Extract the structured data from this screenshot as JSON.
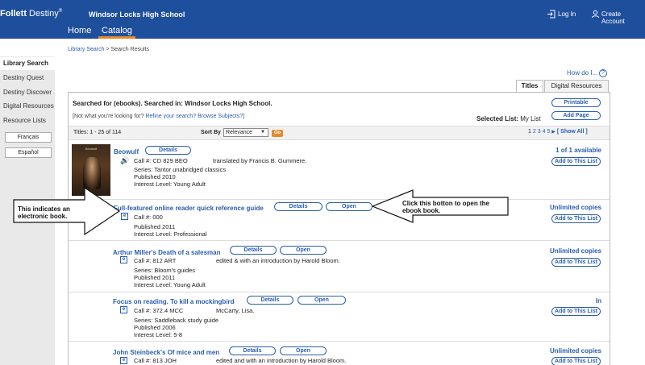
{
  "header": {
    "brand_bold": "Follett",
    "brand_light": " Destiny",
    "brand_mark": "®",
    "school": "Windsor Locks High School",
    "login": "Log In",
    "create_account": "Create Account",
    "nav": [
      "Home",
      "Catalog"
    ]
  },
  "breadcrumb": {
    "link": "Library Search",
    "separator": " > ",
    "current": "Search Results"
  },
  "sidebar": {
    "items": [
      "Library Search",
      "Destiny Quest",
      "Destiny Discover",
      "Digital Resources",
      "Resource Lists"
    ],
    "languages": [
      "Français",
      "Español"
    ]
  },
  "help": {
    "label": "How do I...",
    "icon": "?"
  },
  "tabs": [
    "Titles",
    "Digital Resources"
  ],
  "search": {
    "searched_for": "Searched for (ebooks). Searched in: Windsor Locks High School.",
    "refine_prefix": "[Not what you're looking for? ",
    "refine_link1": "Refine your search?",
    "refine_link2": "Browse Subjects?",
    "refine_suffix": "]",
    "selected_list_label": "Selected List:",
    "selected_list_value": "My List",
    "printable": "Printable",
    "add_page": "Add Page"
  },
  "toolbar": {
    "titles_count": "Titles: 1 - 25 of 114",
    "sort_by": "Sort By",
    "sort_value": "Relevance",
    "go": "Go",
    "pages": [
      "1",
      "2",
      "3",
      "4",
      "5"
    ],
    "next": "▶",
    "show_all": "[ Show All ]"
  },
  "buttons": {
    "details": "Details",
    "open": "Open",
    "add_to_list": "Add to This List"
  },
  "cover": {
    "title": "Beowulf"
  },
  "results": [
    {
      "title": "Beowulf",
      "call": "Call #: CD 829 BEO",
      "author": "translated by Francis B. Gummere.",
      "series": "Series: Tantor unabridged classics",
      "published": "Published 2010",
      "interest": "Interest Level: Young Adult",
      "availability": "1 of 1 available"
    },
    {
      "title": "Full-featured online reader quick reference guide",
      "call": "Call #: 000",
      "published": "Published 2011",
      "interest": "Interest Level: Professional",
      "availability": "Unlimited copies"
    },
    {
      "title": "Arthur Miller's Death of a salesman",
      "call": "Call #: 812 ART",
      "author": "edited & with an introduction by Harold Bloom.",
      "series": "Series: Bloom's guides",
      "published": "Published 2011",
      "interest": "Interest Level: Young Adult",
      "availability": "Unlimited copies"
    },
    {
      "title": "Focus on reading. To kill a mockingbird",
      "call": "Call #: 372.4 MCC",
      "author": "McCarty, Lisa.",
      "series": "Series: Saddleback study guide",
      "published": "Published 2006",
      "interest": "Interest Level: 5-8",
      "availability": "In"
    },
    {
      "title": "John Steinbeck's Of mice and men",
      "call": "Call #: 813 JOH",
      "author": "edited and with an introduction by Harold Bloom.",
      "availability": "Unlimited copies"
    }
  ],
  "annotations": {
    "left": "This indicates an electronic book.",
    "right": "Click this botton to open the ebook book."
  },
  "colors": {
    "header_blue": "#1e4f9c",
    "link_blue": "#2a5db0",
    "accent_orange": "#e38a2c"
  },
  "icons": [
    "login-icon",
    "user-icon",
    "help-icon",
    "speaker-icon",
    "ebook-icon"
  ]
}
